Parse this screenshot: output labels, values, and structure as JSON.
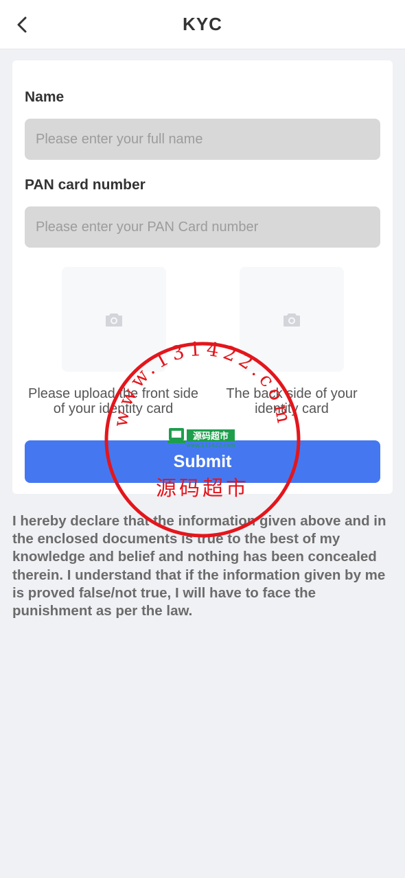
{
  "header": {
    "title": "KYC"
  },
  "form": {
    "name_label": "Name",
    "name_placeholder": "Please enter your full name",
    "pan_label": "PAN card number",
    "pan_placeholder": "Please enter your PAN Card number",
    "front_caption": "Please upload the front side of your identity card",
    "back_caption": "The back side of your identity card",
    "submit_label": "Submit"
  },
  "declaration": "I hereby declare that the information given above and in the enclosed documents is true to the best of my knowledge and belief and nothing has been concealed therein. I understand that if the information given by me is proved false/not true, I will have to face the punishment as per the law.",
  "watermark": {
    "ring_text": "www.131422.com",
    "logo_text": "源码超市",
    "logo_url": "www.131422.com",
    "main_text": "源码超市"
  },
  "icons": {
    "back": "chevron-left-icon",
    "upload": "camera-icon"
  },
  "colors": {
    "accent": "#4578f0",
    "background": "#f0f1f5",
    "input_bg": "#d8d8d8",
    "stamp": "#e3161c"
  }
}
